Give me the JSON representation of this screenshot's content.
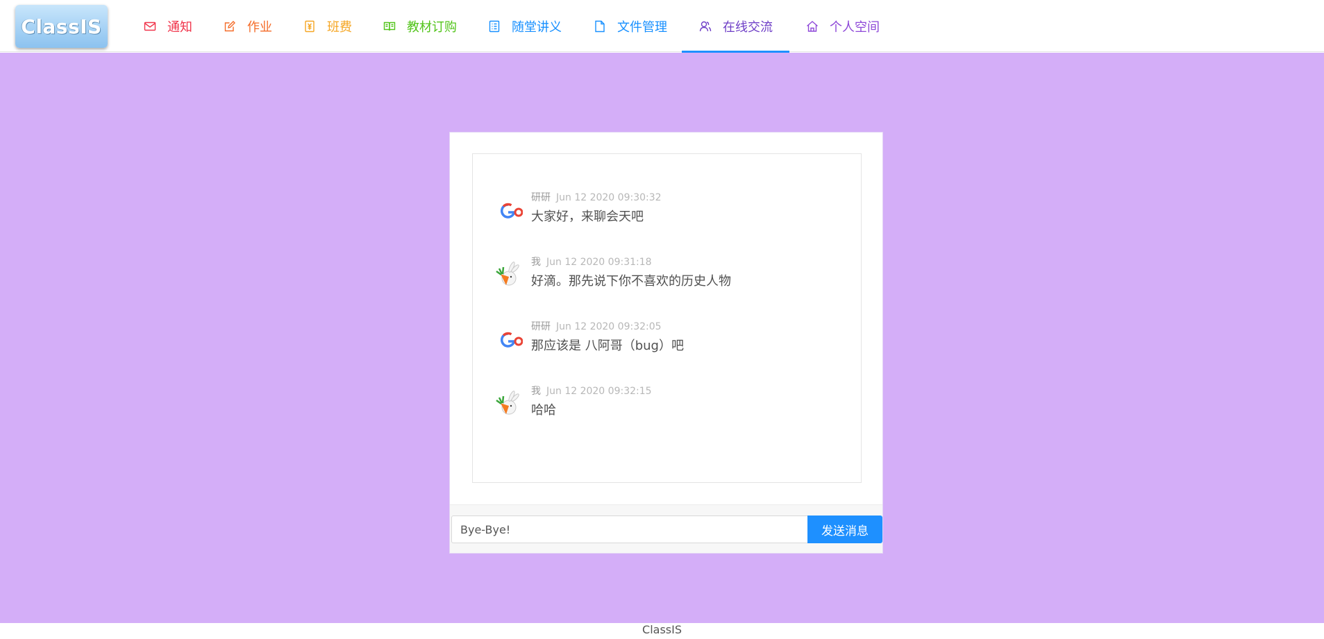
{
  "app": {
    "logo_text": "ClassIS",
    "footer_text": "ClassIS"
  },
  "nav": {
    "items": [
      {
        "label": "通知",
        "icon": "mail-icon",
        "color": "#f0334a"
      },
      {
        "label": "作业",
        "icon": "edit-icon",
        "color": "#f46b28"
      },
      {
        "label": "班费",
        "icon": "money-icon",
        "color": "#f5a623"
      },
      {
        "label": "教材订购",
        "icon": "book-icon",
        "color": "#52c41a"
      },
      {
        "label": "随堂讲义",
        "icon": "list-icon",
        "color": "#1890ff"
      },
      {
        "label": "文件管理",
        "icon": "file-icon",
        "color": "#1890ff"
      },
      {
        "label": "在线交流",
        "icon": "users-icon",
        "color": "#6f3fc7"
      },
      {
        "label": "个人空间",
        "icon": "home-icon",
        "color": "#8e48d8"
      }
    ],
    "active_index": 6,
    "active_color": "#1e90ff"
  },
  "chat": {
    "messages": [
      {
        "sender": "研研",
        "time": "Jun 12 2020 09:30:32",
        "text": "大家好，来聊会天吧",
        "avatar": "google-logo-avatar"
      },
      {
        "sender": "我",
        "time": "Jun 12 2020 09:31:18",
        "text": "好滴。那先说下你不喜欢的历史人物",
        "avatar": "rabbit-avatar"
      },
      {
        "sender": "研研",
        "time": "Jun 12 2020 09:32:05",
        "text": "那应该是 八阿哥（bug）吧",
        "avatar": "google-logo-avatar"
      },
      {
        "sender": "我",
        "time": "Jun 12 2020 09:32:15",
        "text": "哈哈",
        "avatar": "rabbit-avatar"
      }
    ],
    "input_value": "Bye-Bye!",
    "send_label": "发送消息"
  },
  "colors": {
    "background": "#d4aef8",
    "send_button": "#1e90ff"
  }
}
